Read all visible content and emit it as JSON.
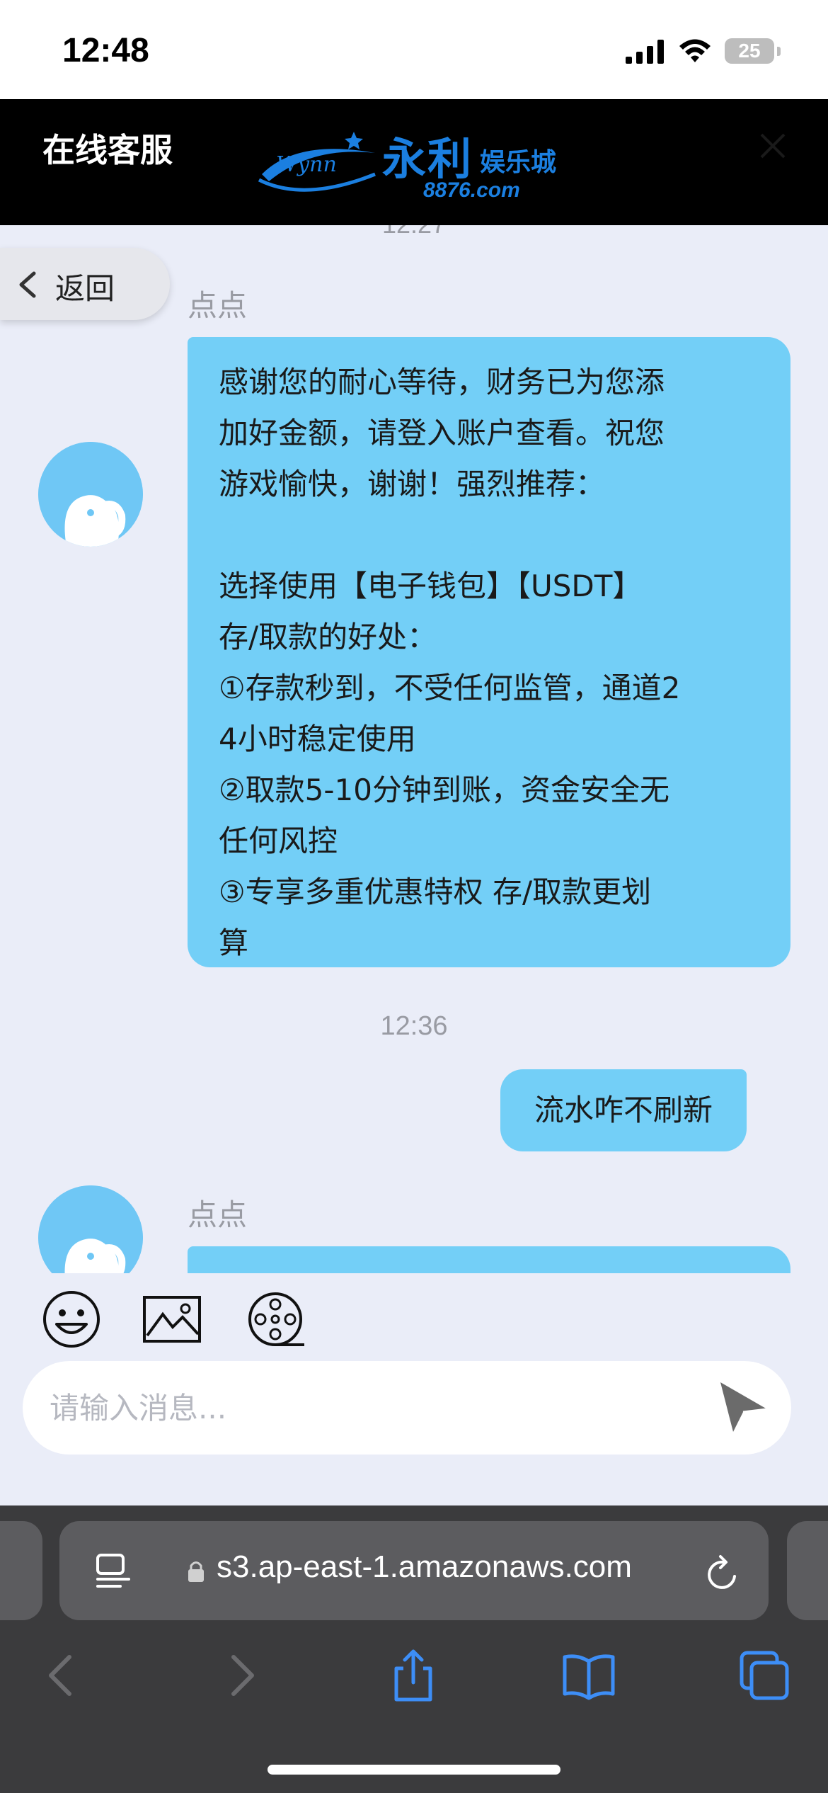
{
  "status_bar": {
    "time": "12:48",
    "battery": "25"
  },
  "header": {
    "title": "在线客服",
    "brand_name": "永利",
    "brand_sub": "娱乐城",
    "brand_domain": "8876.com",
    "brand_script": "Wynn"
  },
  "chat": {
    "timestamp_top": "12:27",
    "messages": [
      {
        "sender": "点点",
        "text": "感谢您的耐心等待，财务已为您添\n加好金额，请登入账户查看。祝您\n游戏愉快，谢谢！强烈推荐：\n\n选择使用【电子钱包】【USDT】\n存/取款的好处：\n①存款秒到，不受任何监管，通道2\n4小时稳定使用\n②取款5-10分钟到账，资金安全无\n任何风控\n③专享多重优惠特权 存/取款更划\n算"
      }
    ],
    "timestamp_mid": "12:36",
    "user_message": "流水咋不刷新",
    "second_sender": "点点"
  },
  "back_button": {
    "label": "返回"
  },
  "input": {
    "placeholder": "请输入消息..."
  },
  "browser": {
    "url": "s3.ap-east-1.amazonaws.com"
  },
  "colors": {
    "bubble": "#73cff7",
    "accent_blue": "#1b7fe0",
    "safari_blue": "#3d8ef7"
  },
  "icons": [
    "emoji-icon",
    "image-icon",
    "video-icon",
    "send-icon",
    "back-icon",
    "reader-icon",
    "lock-icon",
    "reload-icon",
    "share-icon",
    "bookmarks-icon",
    "tabs-icon"
  ]
}
